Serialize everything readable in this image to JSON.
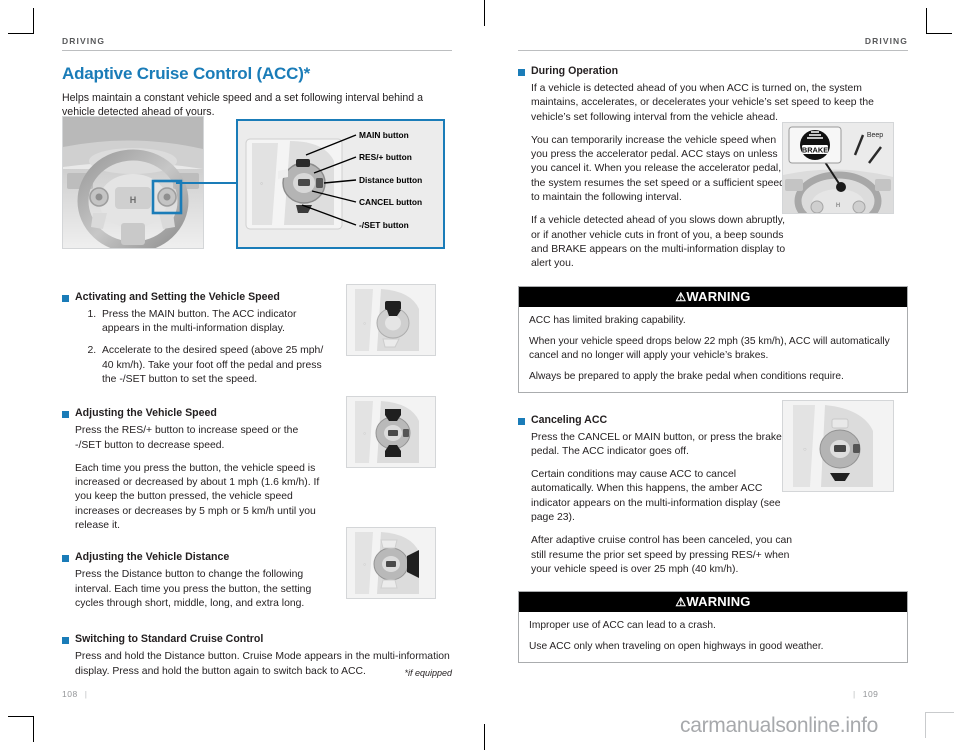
{
  "document": {
    "running_head_left": "DRIVING",
    "running_head_right": "DRIVING",
    "page_left": "108",
    "page_right": "109",
    "footnote": "*if equipped",
    "watermark": "carmanualsonline.info"
  },
  "left_column": {
    "title": "Adaptive Cruise Control (ACC)*",
    "lede": "Helps maintain a constant vehicle speed and a set following interval behind a vehicle detected ahead of yours.",
    "callouts": [
      {
        "label": "MAIN button"
      },
      {
        "label": "RES/+ button"
      },
      {
        "label": "Distance button"
      },
      {
        "label": "CANCEL button"
      },
      {
        "label": "-/SET button"
      }
    ],
    "sections": [
      {
        "heading": "Activating and Setting the Vehicle Speed",
        "steps": [
          "Press the MAIN button. The ACC indicator appears in the multi-information display.",
          "Accelerate to the desired speed (above 25 mph/ 40 km/h). Take your foot off the pedal and press the -/SET button to set the speed."
        ]
      },
      {
        "heading": "Adjusting the Vehicle Speed",
        "paragraphs": [
          "Press the RES/+ button to increase speed or the -/SET button to decrease speed.",
          "Each time you press the button, the vehicle speed is increased or decreased by about 1 mph (1.6 km/h). If you keep the button pressed, the vehicle speed increases or decreases by 5 mph or 5 km/h until you release it."
        ]
      },
      {
        "heading": "Adjusting the Vehicle Distance",
        "paragraphs": [
          "Press the Distance button to change the following interval. Each time you press the button, the setting cycles through short, middle, long, and extra long."
        ]
      },
      {
        "heading": "Switching to Standard Cruise Control",
        "paragraphs": [
          "Press and hold the Distance button. Cruise Mode appears in the multi-information display. Press and hold the button again to switch back to ACC."
        ]
      }
    ]
  },
  "right_column": {
    "sections": [
      {
        "heading": "During Operation",
        "paragraphs": [
          "If a vehicle is detected ahead of you when ACC is turned on, the system maintains, accelerates, or decelerates your vehicle’s set speed to keep the vehicle’s set following interval from the vehicle ahead.",
          "You can temporarily increase the vehicle speed when you press the accelerator pedal. ACC stays on unless you cancel it. When you release the accelerator pedal, the system resumes the set speed or a sufficient speed to maintain the following interval.",
          "If a vehicle detected ahead of you slows down abruptly, or if another vehicle cuts in front of you, a beep sounds and BRAKE appears on the multi-information display to alert you."
        ]
      },
      {
        "heading": "Canceling ACC",
        "paragraphs": [
          "Press the CANCEL or MAIN button, or press the brake pedal. The ACC indicator goes off.",
          "Certain conditions may cause ACC to cancel automatically. When this happens, the amber ACC indicator appears on the multi-information display (see page 23).",
          "After adaptive cruise control has been canceled, you can still resume the prior set speed by pressing RES/+ when your vehicle speed is over 25 mph (40 km/h)."
        ]
      }
    ],
    "warnings": [
      {
        "title": "WARNING",
        "lines": [
          "ACC has limited braking capability.",
          "When your vehicle speed drops below 22 mph (35 km/h), ACC will automatically cancel and no longer will apply your vehicle’s brakes.",
          "Always be prepared to apply the brake pedal when conditions require."
        ]
      },
      {
        "title": "WARNING",
        "lines": [
          "Improper use of ACC can lead to a crash.",
          "Use ACC only when traveling on open highways in good weather."
        ]
      }
    ],
    "figure_labels": {
      "brake": "BRAKE",
      "beep": "Beep"
    }
  },
  "colors": {
    "accent_blue": "#1a7cb8",
    "rule_gray": "#bcbec0",
    "warning_black": "#000000"
  }
}
